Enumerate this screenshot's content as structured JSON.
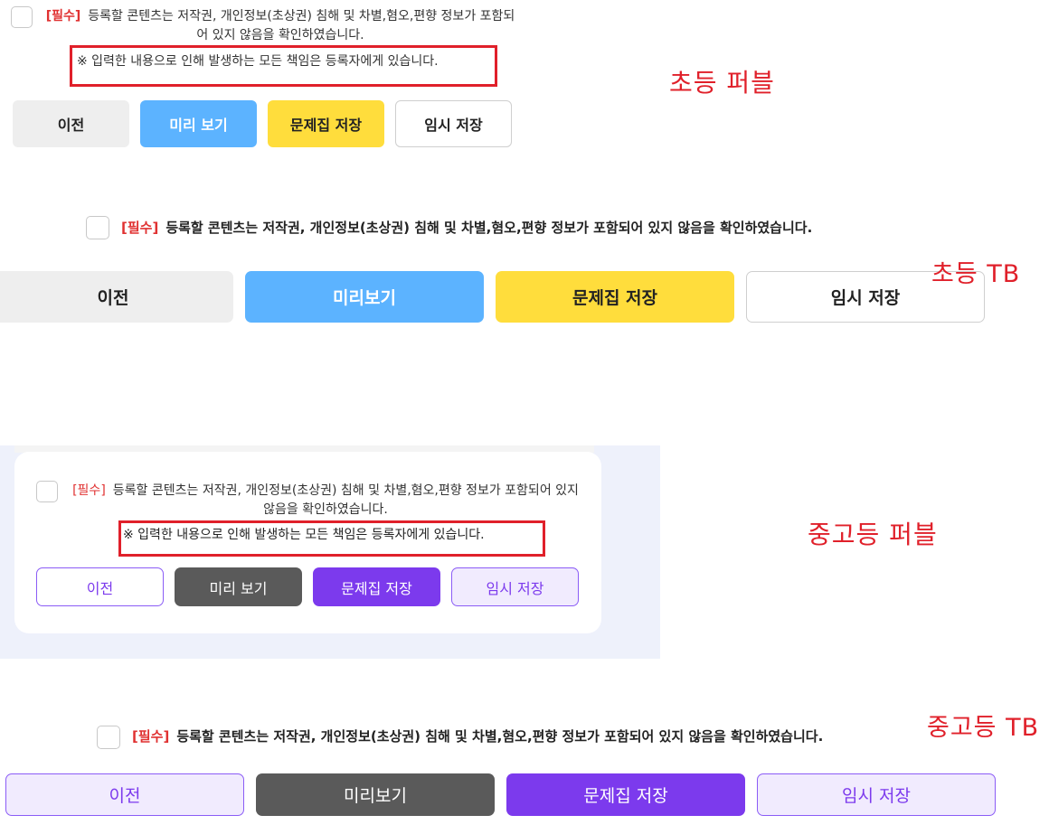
{
  "elementary_pebble": {
    "required_tag": "[필수]",
    "agreement_text": "등록할 콘텐츠는 저작권, 개인정보(초상권) 침해 및 차별,혐오,편향 정보가 포함되어 있지 않음을 확인하였습니다.",
    "notice": "※ 입력한 내용으로 인해 발생하는 모든 책임은 등록자에게 있습니다.",
    "buttons": {
      "prev": "이전",
      "preview": "미리 보기",
      "save_set": "문제집 저장",
      "temp_save": "임시 저장"
    },
    "label": "초등 퍼블"
  },
  "elementary_tb": {
    "required_tag": "[필수]",
    "agreement_text": "등록할 콘텐츠는 저작권, 개인정보(초상권) 침해 및 차별,혐오,편향 정보가 포함되어 있지 않음을 확인하였습니다.",
    "buttons": {
      "prev": "이전",
      "preview": "미리보기",
      "save_set": "문제집 저장",
      "temp_save": "임시 저장"
    },
    "label": "초등 TB"
  },
  "secondary_pebble": {
    "required_tag": "[필수]",
    "agreement_text": "등록할 콘텐츠는 저작권, 개인정보(초상권) 침해 및 차별,혐오,편향 정보가 포함되어 있지 않음을 확인하였습니다.",
    "notice": "※ 입력한 내용으로 인해 발생하는 모든 책임은 등록자에게 있습니다.",
    "buttons": {
      "prev": "이전",
      "preview": "미리 보기",
      "save_set": "문제집 저장",
      "temp_save": "임시 저장"
    },
    "label": "중고등 퍼블"
  },
  "secondary_tb": {
    "required_tag": "[필수]",
    "agreement_text": "등록할 콘텐츠는 저작권, 개인정보(초상권) 침해 및 차별,혐오,편향 정보가 포함되어 있지 않음을 확인하였습니다.",
    "buttons": {
      "prev": "이전",
      "preview": "미리보기",
      "save_set": "문제집 저장",
      "temp_save": "임시 저장"
    },
    "label": "중고등 TB"
  },
  "colors": {
    "annotation_red": "#e0202a",
    "required_red": "#e03131",
    "elementary_blue": "#5cb3ff",
    "elementary_yellow": "#ffdd3c",
    "secondary_purple": "#7c3aed",
    "secondary_gray": "#5a5a5a"
  }
}
